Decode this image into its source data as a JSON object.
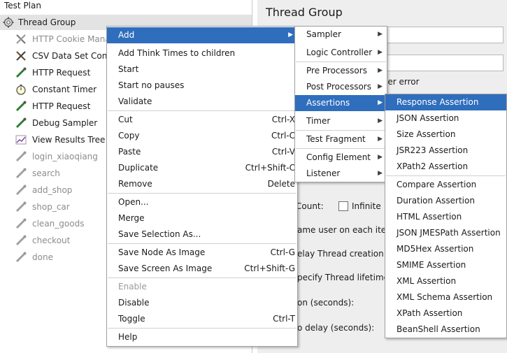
{
  "tree": {
    "items": [
      {
        "label": "Test Plan",
        "icon": "test-plan-icon",
        "disabled": false
      },
      {
        "label": "Thread Group",
        "icon": "gear-icon",
        "disabled": false
      },
      {
        "label": "HTTP Cookie Manager",
        "icon": "tools-icon",
        "disabled": true
      },
      {
        "label": "CSV Data Set Config",
        "icon": "tools-icon",
        "disabled": false
      },
      {
        "label": "HTTP Request",
        "icon": "pipette-icon",
        "disabled": false
      },
      {
        "label": "Constant Timer",
        "icon": "stopwatch-icon",
        "disabled": false
      },
      {
        "label": "HTTP Request",
        "icon": "pipette-icon",
        "disabled": false
      },
      {
        "label": "Debug Sampler",
        "icon": "pipette-icon",
        "disabled": false
      },
      {
        "label": "View Results Tree",
        "icon": "chart-icon",
        "disabled": false
      },
      {
        "label": "login_xiaoqiang",
        "icon": "pipette-icon",
        "disabled": true
      },
      {
        "label": "search",
        "icon": "pipette-icon",
        "disabled": true
      },
      {
        "label": "add_shop",
        "icon": "pipette-icon",
        "disabled": true
      },
      {
        "label": "shop_car",
        "icon": "pipette-icon",
        "disabled": true
      },
      {
        "label": "clean_goods",
        "icon": "pipette-icon",
        "disabled": true
      },
      {
        "label": "checkout",
        "icon": "pipette-icon",
        "disabled": true
      },
      {
        "label": "done",
        "icon": "pipette-icon",
        "disabled": true
      }
    ]
  },
  "panel": {
    "title": "Thread Group",
    "fragments": {
      "on_error": "ler error",
      "loop_count": "Count:",
      "infinite": "Infinite",
      "same_user": "ame user on each itera",
      "delay": "elay Thread creation ur",
      "lifetime": "pecify Thread lifetime",
      "duration": "on (seconds):",
      "startup": "o delay (seconds):"
    }
  },
  "context_menu": {
    "items": [
      {
        "label": "Add",
        "shortcut": "",
        "submenu": true,
        "highlighted": true
      },
      {
        "label": "Add Think Times to children",
        "shortcut": ""
      },
      {
        "label": "Start",
        "shortcut": ""
      },
      {
        "label": "Start no pauses",
        "shortcut": ""
      },
      {
        "label": "Validate",
        "shortcut": ""
      },
      {
        "label": "Cut",
        "shortcut": "Ctrl-X"
      },
      {
        "label": "Copy",
        "shortcut": "Ctrl-C"
      },
      {
        "label": "Paste",
        "shortcut": "Ctrl-V"
      },
      {
        "label": "Duplicate",
        "shortcut": "Ctrl+Shift-C"
      },
      {
        "label": "Remove",
        "shortcut": "Delete"
      },
      {
        "label": "Open...",
        "shortcut": ""
      },
      {
        "label": "Merge",
        "shortcut": ""
      },
      {
        "label": "Save Selection As...",
        "shortcut": ""
      },
      {
        "label": "Save Node As Image",
        "shortcut": "Ctrl-G"
      },
      {
        "label": "Save Screen As Image",
        "shortcut": "Ctrl+Shift-G"
      },
      {
        "label": "Enable",
        "shortcut": "",
        "disabled": true
      },
      {
        "label": "Disable",
        "shortcut": ""
      },
      {
        "label": "Toggle",
        "shortcut": "Ctrl-T"
      },
      {
        "label": "Help",
        "shortcut": ""
      }
    ]
  },
  "add_submenu": {
    "items": [
      {
        "label": "Sampler",
        "submenu": true
      },
      {
        "label": "Logic Controller",
        "submenu": true
      },
      {
        "label": "Pre Processors",
        "submenu": true
      },
      {
        "label": "Post Processors",
        "submenu": true
      },
      {
        "label": "Assertions",
        "submenu": true,
        "highlighted": true
      },
      {
        "label": "Timer",
        "submenu": true
      },
      {
        "label": "Test Fragment",
        "submenu": true
      },
      {
        "label": "Config Element",
        "submenu": true
      },
      {
        "label": "Listener",
        "submenu": true
      }
    ]
  },
  "assertions_submenu": {
    "items": [
      {
        "label": "Response Assertion",
        "highlighted": true
      },
      {
        "label": "JSON Assertion"
      },
      {
        "label": "Size Assertion"
      },
      {
        "label": "JSR223 Assertion"
      },
      {
        "label": "XPath2 Assertion"
      },
      {
        "label": "Compare Assertion"
      },
      {
        "label": "Duration Assertion"
      },
      {
        "label": "HTML Assertion"
      },
      {
        "label": "JSON JMESPath Assertion"
      },
      {
        "label": "MD5Hex Assertion"
      },
      {
        "label": "SMIME Assertion"
      },
      {
        "label": "XML Assertion"
      },
      {
        "label": "XML Schema Assertion"
      },
      {
        "label": "XPath Assertion"
      },
      {
        "label": "BeanShell Assertion"
      }
    ]
  },
  "colors": {
    "highlight": "#2f6ebd",
    "selected_row": "#e3e3e3",
    "disabled_text": "#8c8c8c"
  }
}
